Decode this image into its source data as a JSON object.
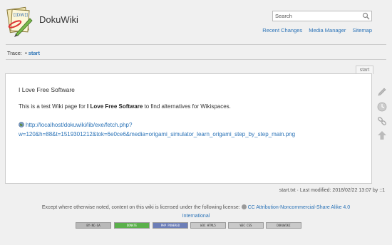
{
  "header": {
    "site_title": "DokuWiki",
    "search_placeholder": "Search",
    "tools": [
      "Recent Changes",
      "Media Manager",
      "Sitemap"
    ]
  },
  "trace": {
    "label": "Trace:",
    "separator": "•",
    "crumb": "start"
  },
  "page": {
    "tab": "start",
    "heading": "I Love Free Software",
    "para_before": "This is a test Wiki page for ",
    "para_bold": "I Love Free Software",
    "para_after": " to find alternatives for Wikispaces.",
    "link_line1": "http://localhost/dokuwiki/lib/exe/fetch.php?",
    "link_line2": "w=120&h=88&t=1519301212&tok=6e0ce6&media=origami_simulator_learn_origami_step_by_step_main.png"
  },
  "docinfo": "start.txt · Last modified: 2018/02/22 13:07 by ::1",
  "footer": {
    "license_prefix": "Except where otherwise noted, content on this wiki is licensed under the following license:",
    "license_line1": "CC Attribution-Noncommercial-Share Alike 4.0",
    "license_line2": "International"
  },
  "badges": [
    {
      "name": "cc-badge",
      "color": "#b8b8b8",
      "text": "BY-NC-SA"
    },
    {
      "name": "donate-badge",
      "color": "#5ab04b",
      "text": "DONATE"
    },
    {
      "name": "php-badge",
      "color": "#6c7eb7",
      "text": "PHP POWERED"
    },
    {
      "name": "html5-badge",
      "color": "#c9c9c9",
      "text": "W3C HTML5"
    },
    {
      "name": "css-badge",
      "color": "#c9c9c9",
      "text": "W3C CSS"
    },
    {
      "name": "dokuwiki-badge",
      "color": "#c9c9c9",
      "text": "DOKUWIKI"
    }
  ],
  "colors": {
    "link": "#2b73b7",
    "background": "#f0f0f0"
  },
  "icons": [
    "dokuwiki-logo",
    "search-icon",
    "globe-icon",
    "edit-icon",
    "revisions-icon",
    "backlinks-icon",
    "back-to-top-icon",
    "cc-icon"
  ]
}
